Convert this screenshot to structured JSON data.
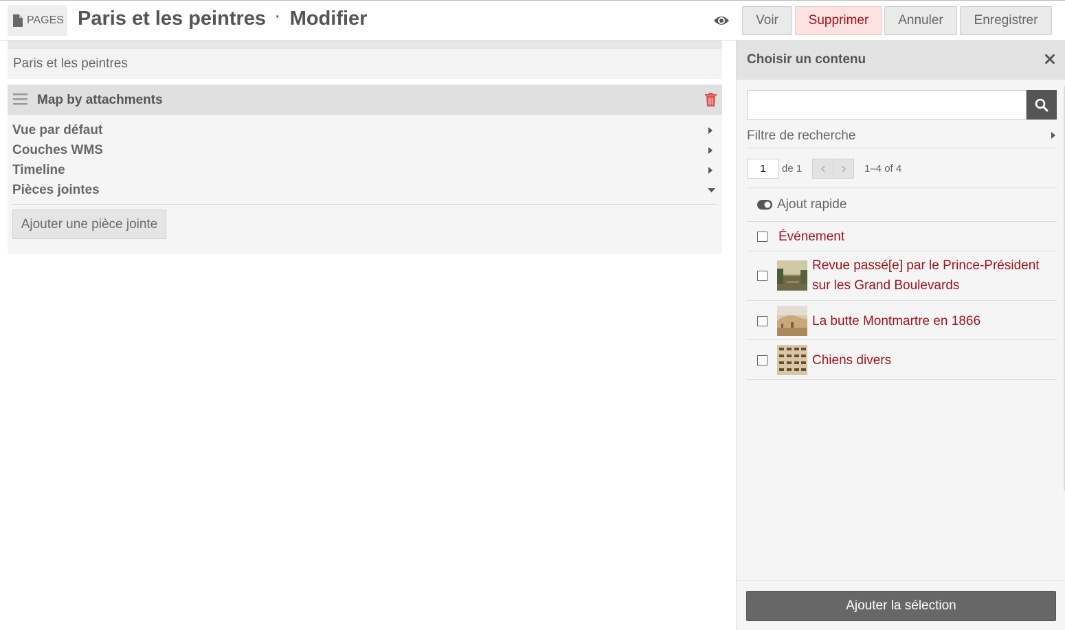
{
  "header": {
    "section_label": "PAGES",
    "page_title": "Paris et les peintres",
    "separator": "·",
    "mode": "Modifier",
    "buttons": {
      "view": "Voir",
      "delete": "Supprimer",
      "cancel": "Annuler",
      "save": "Enregistrer"
    }
  },
  "editor": {
    "title_value": "Paris et les peintres",
    "block": {
      "title": "Map by attachments",
      "options": [
        {
          "label": "Vue par défaut",
          "expanded": false
        },
        {
          "label": "Couches WMS",
          "expanded": false
        },
        {
          "label": "Timeline",
          "expanded": false
        },
        {
          "label": "Pièces jointes",
          "expanded": true
        }
      ],
      "add_attachment_label": "Ajouter une pièce jointe"
    }
  },
  "sidebar": {
    "title": "Choisir un contenu",
    "search": {
      "value": "",
      "placeholder": ""
    },
    "filter_label": "Filtre de recherche",
    "pager": {
      "current_page": "1",
      "of_label": "de 1",
      "range": "1–4 of 4"
    },
    "quick_add_label": "Ajout rapide",
    "items": [
      {
        "label": "Événement",
        "has_thumb": false
      },
      {
        "label": "Revue passé[e] par le Prince-Président sur les Grand Boulevards",
        "has_thumb": true
      },
      {
        "label": "La butte Montmartre en 1866",
        "has_thumb": true
      },
      {
        "label": "Chiens divers",
        "has_thumb": true
      }
    ],
    "add_selection_label": "Ajouter la sélection"
  },
  "colors": {
    "accent_red": "#a3121c",
    "dark_button": "#676767",
    "panel_bg": "#f5f5f5"
  }
}
